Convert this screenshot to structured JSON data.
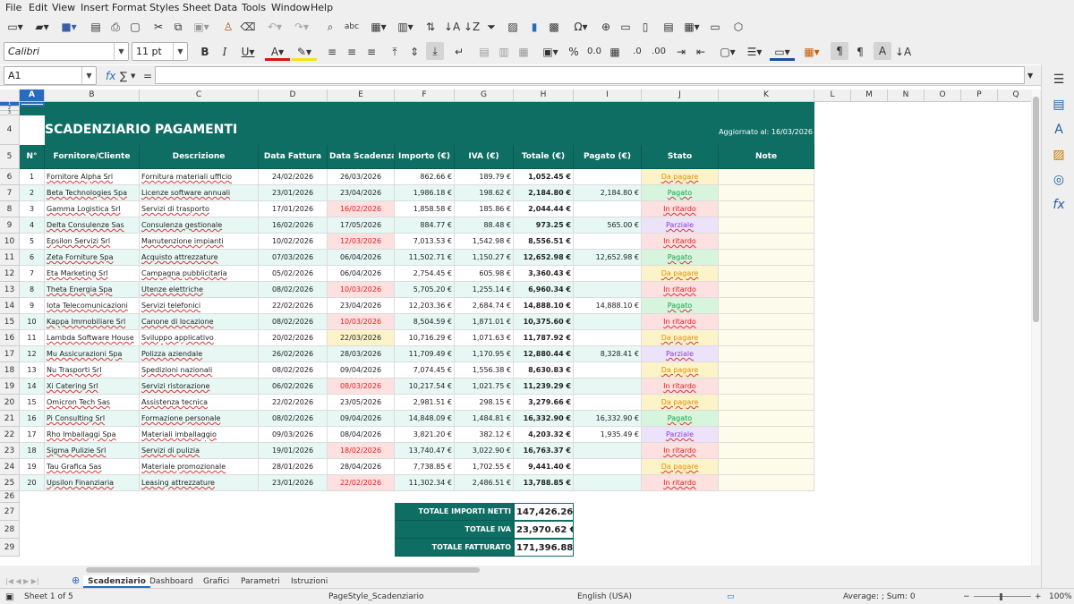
{
  "menu": [
    "File",
    "Edit",
    "View",
    "Insert",
    "Format",
    "Styles",
    "Sheet",
    "Data",
    "Tools",
    "Window",
    "Help"
  ],
  "font": {
    "name": "Calibri",
    "size": "11 pt"
  },
  "name_box": "A1",
  "formula_symbols": {
    "fx": "fx",
    "sum": "∑",
    "eq": "="
  },
  "formula_value": "",
  "columns": [
    "A",
    "B",
    "C",
    "D",
    "E",
    "F",
    "G",
    "H",
    "I",
    "J",
    "K",
    "L",
    "M",
    "N",
    "O",
    "P",
    "Q"
  ],
  "sheet": {
    "title": "SCADENZIARIO PAGAMENTI",
    "updated": "Aggiornato al: 16/03/2026",
    "headers": [
      "N°",
      "Fornitore/Cliente",
      "Descrizione",
      "Data Fattura",
      "Data Scadenza",
      "Importo (€)",
      "IVA (€)",
      "Totale (€)",
      "Pagato (€)",
      "Stato",
      "Note"
    ],
    "rows": [
      {
        "row": "6",
        "n": "1",
        "fornitore": "Fornitore Alpha Srl",
        "descrizione": "Fornitura materiali ufficio",
        "data_fattura": "24/02/2026",
        "data_scadenza": "26/03/2026",
        "importo": "862.66 €",
        "iva": "189.79 €",
        "totale": "1,052.45 €",
        "pagato": "",
        "stato": "Da pagare",
        "scad_flag": ""
      },
      {
        "row": "7",
        "n": "2",
        "fornitore": "Beta Technologies Spa",
        "descrizione": "Licenze software annuali",
        "data_fattura": "23/01/2026",
        "data_scadenza": "23/04/2026",
        "importo": "1,986.18 €",
        "iva": "198.62 €",
        "totale": "2,184.80 €",
        "pagato": "2,184.80 €",
        "stato": "Pagato",
        "scad_flag": ""
      },
      {
        "row": "8",
        "n": "3",
        "fornitore": "Gamma Logistica Srl",
        "descrizione": "Servizi di trasporto",
        "data_fattura": "17/01/2026",
        "data_scadenza": "16/02/2026",
        "importo": "1,858.58 €",
        "iva": "185.86 €",
        "totale": "2,044.44 €",
        "pagato": "",
        "stato": "In ritardo",
        "scad_flag": "overdue"
      },
      {
        "row": "9",
        "n": "4",
        "fornitore": "Delta Consulenze Sas",
        "descrizione": "Consulenza gestionale",
        "data_fattura": "16/02/2026",
        "data_scadenza": "17/05/2026",
        "importo": "884.77 €",
        "iva": "88.48 €",
        "totale": "973.25 €",
        "pagato": "565.00 €",
        "stato": "Parziale",
        "scad_flag": ""
      },
      {
        "row": "10",
        "n": "5",
        "fornitore": "Epsilon Servizi Srl",
        "descrizione": "Manutenzione impianti",
        "data_fattura": "10/02/2026",
        "data_scadenza": "12/03/2026",
        "importo": "7,013.53 €",
        "iva": "1,542.98 €",
        "totale": "8,556.51 €",
        "pagato": "",
        "stato": "In ritardo",
        "scad_flag": "overdue"
      },
      {
        "row": "11",
        "n": "6",
        "fornitore": "Zeta Forniture Spa",
        "descrizione": "Acquisto attrezzature",
        "data_fattura": "07/03/2026",
        "data_scadenza": "06/04/2026",
        "importo": "11,502.71 €",
        "iva": "1,150.27 €",
        "totale": "12,652.98 €",
        "pagato": "12,652.98 €",
        "stato": "Pagato",
        "scad_flag": ""
      },
      {
        "row": "12",
        "n": "7",
        "fornitore": "Eta Marketing Srl",
        "descrizione": "Campagna pubblicitaria",
        "data_fattura": "05/02/2026",
        "data_scadenza": "06/04/2026",
        "importo": "2,754.45 €",
        "iva": "605.98 €",
        "totale": "3,360.43 €",
        "pagato": "",
        "stato": "Da pagare",
        "scad_flag": ""
      },
      {
        "row": "13",
        "n": "8",
        "fornitore": "Theta Energia Spa",
        "descrizione": "Utenze elettriche",
        "data_fattura": "08/02/2026",
        "data_scadenza": "10/03/2026",
        "importo": "5,705.20 €",
        "iva": "1,255.14 €",
        "totale": "6,960.34 €",
        "pagato": "",
        "stato": "In ritardo",
        "scad_flag": "overdue"
      },
      {
        "row": "14",
        "n": "9",
        "fornitore": "Iota Telecomunicazioni",
        "descrizione": "Servizi telefonici",
        "data_fattura": "22/02/2026",
        "data_scadenza": "23/04/2026",
        "importo": "12,203.36 €",
        "iva": "2,684.74 €",
        "totale": "14,888.10 €",
        "pagato": "14,888.10 €",
        "stato": "Pagato",
        "scad_flag": ""
      },
      {
        "row": "15",
        "n": "10",
        "fornitore": "Kappa Immobiliare Srl",
        "descrizione": "Canone di locazione",
        "data_fattura": "08/02/2026",
        "data_scadenza": "10/03/2026",
        "importo": "8,504.59 €",
        "iva": "1,871.01 €",
        "totale": "10,375.60 €",
        "pagato": "",
        "stato": "In ritardo",
        "scad_flag": "overdue"
      },
      {
        "row": "16",
        "n": "11",
        "fornitore": "Lambda Software House",
        "descrizione": "Sviluppo applicativo",
        "data_fattura": "20/02/2026",
        "data_scadenza": "22/03/2026",
        "importo": "10,716.29 €",
        "iva": "1,071.63 €",
        "totale": "11,787.92 €",
        "pagato": "",
        "stato": "Da pagare",
        "scad_flag": "soon"
      },
      {
        "row": "17",
        "n": "12",
        "fornitore": "Mu Assicurazioni Spa",
        "descrizione": "Polizza aziendale",
        "data_fattura": "26/02/2026",
        "data_scadenza": "28/03/2026",
        "importo": "11,709.49 €",
        "iva": "1,170.95 €",
        "totale": "12,880.44 €",
        "pagato": "8,328.41 €",
        "stato": "Parziale",
        "scad_flag": ""
      },
      {
        "row": "18",
        "n": "13",
        "fornitore": "Nu Trasporti Srl",
        "descrizione": "Spedizioni nazionali",
        "data_fattura": "08/02/2026",
        "data_scadenza": "09/04/2026",
        "importo": "7,074.45 €",
        "iva": "1,556.38 €",
        "totale": "8,630.83 €",
        "pagato": "",
        "stato": "Da pagare",
        "scad_flag": ""
      },
      {
        "row": "19",
        "n": "14",
        "fornitore": "Xi Catering Srl",
        "descrizione": "Servizi ristorazione",
        "data_fattura": "06/02/2026",
        "data_scadenza": "08/03/2026",
        "importo": "10,217.54 €",
        "iva": "1,021.75 €",
        "totale": "11,239.29 €",
        "pagato": "",
        "stato": "In ritardo",
        "scad_flag": "overdue"
      },
      {
        "row": "20",
        "n": "15",
        "fornitore": "Omicron Tech Sas",
        "descrizione": "Assistenza tecnica",
        "data_fattura": "22/02/2026",
        "data_scadenza": "23/05/2026",
        "importo": "2,981.51 €",
        "iva": "298.15 €",
        "totale": "3,279.66 €",
        "pagato": "",
        "stato": "Da pagare",
        "scad_flag": ""
      },
      {
        "row": "21",
        "n": "16",
        "fornitore": "Pi Consulting Srl",
        "descrizione": "Formazione personale",
        "data_fattura": "08/02/2026",
        "data_scadenza": "09/04/2026",
        "importo": "14,848.09 €",
        "iva": "1,484.81 €",
        "totale": "16,332.90 €",
        "pagato": "16,332.90 €",
        "stato": "Pagato",
        "scad_flag": ""
      },
      {
        "row": "22",
        "n": "17",
        "fornitore": "Rho Imballaggi Spa",
        "descrizione": "Materiali imballaggio",
        "data_fattura": "09/03/2026",
        "data_scadenza": "08/04/2026",
        "importo": "3,821.20 €",
        "iva": "382.12 €",
        "totale": "4,203.32 €",
        "pagato": "1,935.49 €",
        "stato": "Parziale",
        "scad_flag": ""
      },
      {
        "row": "23",
        "n": "18",
        "fornitore": "Sigma Pulizie Srl",
        "descrizione": "Servizi di pulizia",
        "data_fattura": "19/01/2026",
        "data_scadenza": "18/02/2026",
        "importo": "13,740.47 €",
        "iva": "3,022.90 €",
        "totale": "16,763.37 €",
        "pagato": "",
        "stato": "In ritardo",
        "scad_flag": "overdue"
      },
      {
        "row": "24",
        "n": "19",
        "fornitore": "Tau Grafica Sas",
        "descrizione": "Materiale promozionale",
        "data_fattura": "28/01/2026",
        "data_scadenza": "28/04/2026",
        "importo": "7,738.85 €",
        "iva": "1,702.55 €",
        "totale": "9,441.40 €",
        "pagato": "",
        "stato": "Da pagare",
        "scad_flag": ""
      },
      {
        "row": "25",
        "n": "20",
        "fornitore": "Upsilon Finanziaria",
        "descrizione": "Leasing attrezzature",
        "data_fattura": "23/01/2026",
        "data_scadenza": "22/02/2026",
        "importo": "11,302.34 €",
        "iva": "2,486.51 €",
        "totale": "13,788.85 €",
        "pagato": "",
        "stato": "In ritardo",
        "scad_flag": "overdue"
      }
    ],
    "totals": [
      {
        "row": "27",
        "label": "TOTALE IMPORTI NETTI",
        "value": "147,426.26 €"
      },
      {
        "row": "28",
        "label": "TOTALE IVA",
        "value": "23,970.62 €"
      },
      {
        "row": "29",
        "label": "TOTALE FATTURATO",
        "value": "171,396.88 €"
      }
    ]
  },
  "sheet_tabs": [
    "Scadenziario",
    "Dashboard",
    "Grafici",
    "Parametri",
    "Istruzioni"
  ],
  "active_tab": "Scadenziario",
  "status": {
    "sheet": "Sheet 1 of 5",
    "page_style": "PageStyle_Scadenziario",
    "language": "English (USA)",
    "summary": "Average: ; Sum: 0",
    "zoom": "100%"
  },
  "colors": {
    "teal": "#0f6e63",
    "light_row": "#e6f7f4",
    "overdue_bg": "#fde0e0",
    "overdue_fg": "#e02020",
    "soon_bg": "#fdf3c8",
    "paid_bg": "#d7f4dc",
    "paid_fg": "#17a34a",
    "due_bg": "#fdf3c8",
    "due_fg": "#e09000",
    "partial_bg": "#ece3fb",
    "partial_fg": "#8b3fd6",
    "note_bg": "#fdfbea"
  }
}
